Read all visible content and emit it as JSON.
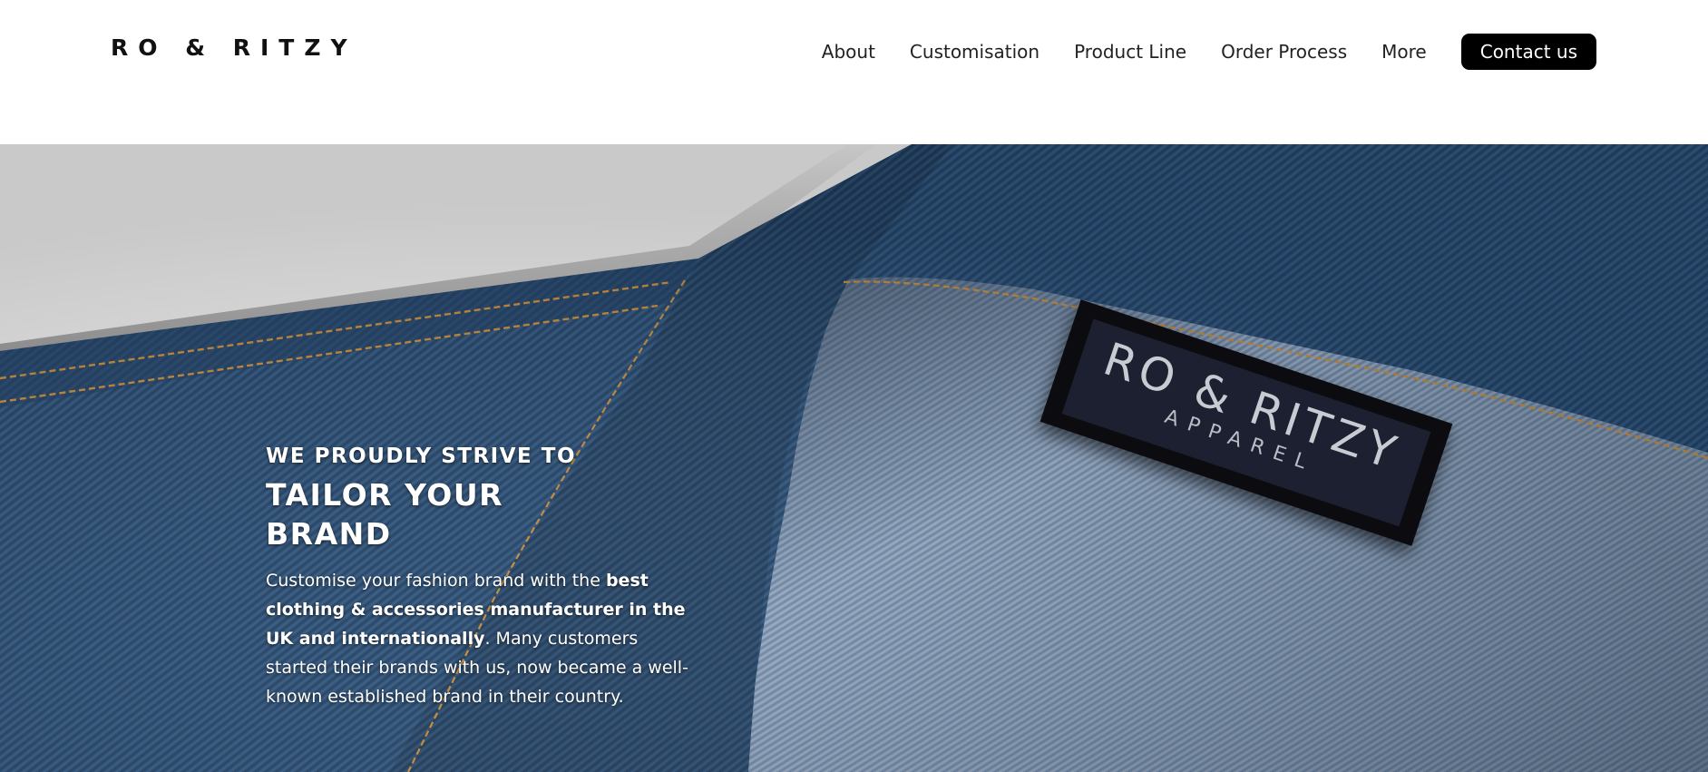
{
  "header": {
    "logo": "RO & RITZY",
    "nav": [
      {
        "label": "About"
      },
      {
        "label": "Customisation"
      },
      {
        "label": "Product Line"
      },
      {
        "label": "Order Process"
      },
      {
        "label": "More"
      }
    ],
    "cta_label": "Contact us"
  },
  "hero": {
    "eyebrow": "WE PROUDLY STRIVE TO",
    "headline": "TAILOR YOUR BRAND",
    "body": {
      "part1": "Customise your fashion brand with the ",
      "bold": "best clothing & accessories manufacturer in the UK and internationally",
      "part2": ". Many customers started their brands with us, now became a well-known established brand in their country."
    },
    "label_patch": {
      "brand": "RO & RITZY",
      "sub": "APPAREL"
    }
  },
  "colors": {
    "denim_dark": "#23456a",
    "denim_light": "#7d95b3",
    "stitch": "#c48a3a",
    "backdrop": "#e6e6e6",
    "button": "#000000"
  }
}
